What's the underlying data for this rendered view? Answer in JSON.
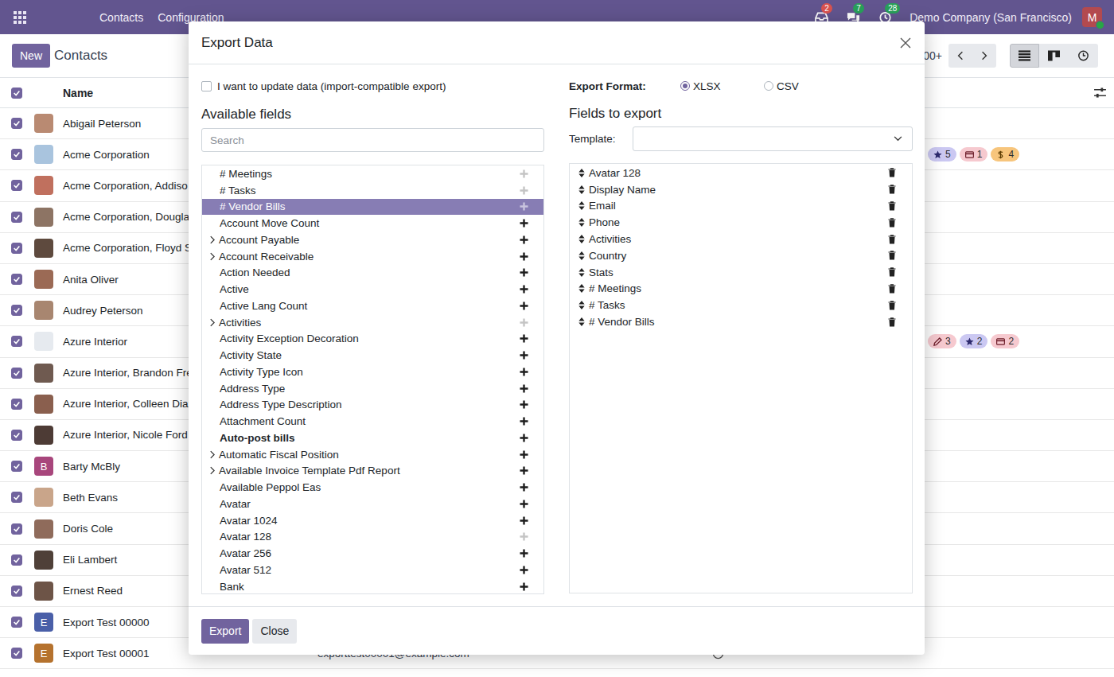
{
  "navbar": {
    "menu": [
      "Contacts",
      "Configuration"
    ],
    "systray": [
      {
        "kind": "tray",
        "count": "2",
        "color": "#d9534f"
      },
      {
        "kind": "chat",
        "count": "7",
        "color": "#28a05a"
      },
      {
        "kind": "clock",
        "count": "28",
        "color": "#28a05a"
      }
    ],
    "company": "Demo Company (San Francisco)",
    "avatar": "M"
  },
  "control_panel": {
    "new_button": "New",
    "breadcrumb": "Contacts",
    "pager": "00+",
    "views": [
      {
        "kind": "list",
        "selected": true
      },
      {
        "kind": "kanban",
        "selected": false
      },
      {
        "kind": "activity",
        "selected": false
      }
    ]
  },
  "list": {
    "all_checked": true,
    "column": "Name",
    "rows": [
      {
        "name": "Abigail Peterson",
        "checked": true,
        "avatar": {
          "kind": "photo",
          "color": "#b98a72"
        },
        "badges": []
      },
      {
        "name": "Acme Corporation",
        "checked": true,
        "avatar": {
          "kind": "photo",
          "color": "#a9c4de"
        },
        "badges": [
          {
            "kind": "star",
            "count": "5",
            "color": "#cbc8f2"
          },
          {
            "kind": "bill",
            "count": "1",
            "color": "#f6c9cf"
          },
          {
            "kind": "dollar",
            "count": "4",
            "color": "#f7c57c"
          }
        ]
      },
      {
        "name": "Acme Corporation, Addiso",
        "checked": true,
        "avatar": {
          "kind": "photo",
          "color": "#c0705e"
        },
        "badges": []
      },
      {
        "name": "Acme Corporation, Douglas",
        "checked": true,
        "avatar": {
          "kind": "photo",
          "color": "#8d7464"
        },
        "badges": []
      },
      {
        "name": "Acme Corporation, Floyd St",
        "checked": true,
        "avatar": {
          "kind": "photo",
          "color": "#5e4a3e"
        },
        "badges": []
      },
      {
        "name": "Anita Oliver",
        "checked": true,
        "avatar": {
          "kind": "photo",
          "color": "#9b6a55"
        },
        "badges": []
      },
      {
        "name": "Audrey Peterson",
        "checked": true,
        "avatar": {
          "kind": "photo",
          "color": "#a88670"
        },
        "badges": []
      },
      {
        "name": "Azure Interior",
        "checked": true,
        "avatar": {
          "kind": "photo",
          "color": "#e6eaef"
        },
        "badges": [
          {
            "kind": "pencil",
            "count": "3",
            "color": "#f6c9cf"
          },
          {
            "kind": "star",
            "count": "2",
            "color": "#cbc8f2"
          },
          {
            "kind": "bill",
            "count": "2",
            "color": "#f6c9cf"
          }
        ]
      },
      {
        "name": "Azure Interior, Brandon Fre",
        "checked": true,
        "avatar": {
          "kind": "photo",
          "color": "#6f5a50"
        },
        "badges": []
      },
      {
        "name": "Azure Interior, Colleen Diaz",
        "checked": true,
        "avatar": {
          "kind": "photo",
          "color": "#8a5f4e"
        },
        "badges": []
      },
      {
        "name": "Azure Interior, Nicole Ford",
        "checked": true,
        "avatar": {
          "kind": "photo",
          "color": "#4d3b35"
        },
        "badges": []
      },
      {
        "name": "Barty McBly",
        "checked": true,
        "avatar": {
          "kind": "letter",
          "letter": "B",
          "color": "#a8467c"
        },
        "badges": []
      },
      {
        "name": "Beth Evans",
        "checked": true,
        "avatar": {
          "kind": "photo",
          "color": "#c9a58a"
        },
        "badges": []
      },
      {
        "name": "Doris Cole",
        "checked": true,
        "avatar": {
          "kind": "photo",
          "color": "#8f6b5b"
        },
        "badges": []
      },
      {
        "name": "Eli Lambert",
        "checked": true,
        "avatar": {
          "kind": "photo",
          "color": "#4f4038"
        },
        "badges": []
      },
      {
        "name": "Ernest Reed",
        "checked": true,
        "avatar": {
          "kind": "photo",
          "color": "#6d5447"
        },
        "badges": []
      },
      {
        "name": "Export Test 00000",
        "checked": true,
        "avatar": {
          "kind": "letter",
          "letter": "E",
          "color": "#4a5fa8"
        },
        "badges": []
      },
      {
        "name": "Export Test 00001",
        "checked": true,
        "avatar": {
          "kind": "letter",
          "letter": "E",
          "color": "#b5722e"
        },
        "email": "exporttest00001@example.com",
        "activity": true,
        "badges": []
      }
    ]
  },
  "dialog": {
    "title": "Export Data",
    "import_compatible": {
      "label": "I want to update data (import-compatible export)",
      "checked": false
    },
    "format": {
      "label": "Export Format:",
      "options": [
        {
          "label": "XLSX",
          "selected": true
        },
        {
          "label": "CSV",
          "selected": false
        }
      ]
    },
    "available": {
      "title": "Available fields",
      "search_placeholder": "Search",
      "fields": [
        {
          "label": "# Meetings",
          "expandable": false,
          "added": true,
          "selected": false,
          "required": false
        },
        {
          "label": "# Tasks",
          "expandable": false,
          "added": true,
          "selected": false,
          "required": false
        },
        {
          "label": "# Vendor Bills",
          "expandable": false,
          "added": true,
          "selected": true,
          "required": false
        },
        {
          "label": "Account Move Count",
          "expandable": false,
          "added": false,
          "selected": false,
          "required": false
        },
        {
          "label": "Account Payable",
          "expandable": true,
          "added": false,
          "selected": false,
          "required": false
        },
        {
          "label": "Account Receivable",
          "expandable": true,
          "added": false,
          "selected": false,
          "required": false
        },
        {
          "label": "Action Needed",
          "expandable": false,
          "added": false,
          "selected": false,
          "required": false
        },
        {
          "label": "Active",
          "expandable": false,
          "added": false,
          "selected": false,
          "required": false
        },
        {
          "label": "Active Lang Count",
          "expandable": false,
          "added": false,
          "selected": false,
          "required": false
        },
        {
          "label": "Activities",
          "expandable": true,
          "added": true,
          "selected": false,
          "required": false
        },
        {
          "label": "Activity Exception Decoration",
          "expandable": false,
          "added": false,
          "selected": false,
          "required": false
        },
        {
          "label": "Activity State",
          "expandable": false,
          "added": false,
          "selected": false,
          "required": false
        },
        {
          "label": "Activity Type Icon",
          "expandable": false,
          "added": false,
          "selected": false,
          "required": false
        },
        {
          "label": "Address Type",
          "expandable": false,
          "added": false,
          "selected": false,
          "required": false
        },
        {
          "label": "Address Type Description",
          "expandable": false,
          "added": false,
          "selected": false,
          "required": false
        },
        {
          "label": "Attachment Count",
          "expandable": false,
          "added": false,
          "selected": false,
          "required": false
        },
        {
          "label": "Auto-post bills",
          "expandable": false,
          "added": false,
          "selected": false,
          "required": true
        },
        {
          "label": "Automatic Fiscal Position",
          "expandable": true,
          "added": false,
          "selected": false,
          "required": false
        },
        {
          "label": "Available Invoice Template Pdf Report",
          "expandable": true,
          "added": false,
          "selected": false,
          "required": false
        },
        {
          "label": "Available Peppol Eas",
          "expandable": false,
          "added": false,
          "selected": false,
          "required": false
        },
        {
          "label": "Avatar",
          "expandable": false,
          "added": false,
          "selected": false,
          "required": false
        },
        {
          "label": "Avatar 1024",
          "expandable": false,
          "added": false,
          "selected": false,
          "required": false
        },
        {
          "label": "Avatar 128",
          "expandable": false,
          "added": true,
          "selected": false,
          "required": false
        },
        {
          "label": "Avatar 256",
          "expandable": false,
          "added": false,
          "selected": false,
          "required": false
        },
        {
          "label": "Avatar 512",
          "expandable": false,
          "added": false,
          "selected": false,
          "required": false
        },
        {
          "label": "Bank",
          "expandable": false,
          "added": false,
          "selected": false,
          "required": false
        }
      ]
    },
    "export": {
      "title": "Fields to export",
      "template_label": "Template:",
      "fields": [
        "Avatar 128",
        "Display Name",
        "Email",
        "Phone",
        "Activities",
        "Country",
        "Stats",
        "# Meetings",
        "# Tasks",
        "# Vendor Bills"
      ]
    },
    "buttons": [
      {
        "label": "Export",
        "primary": true
      },
      {
        "label": "Close",
        "primary": false
      }
    ]
  }
}
